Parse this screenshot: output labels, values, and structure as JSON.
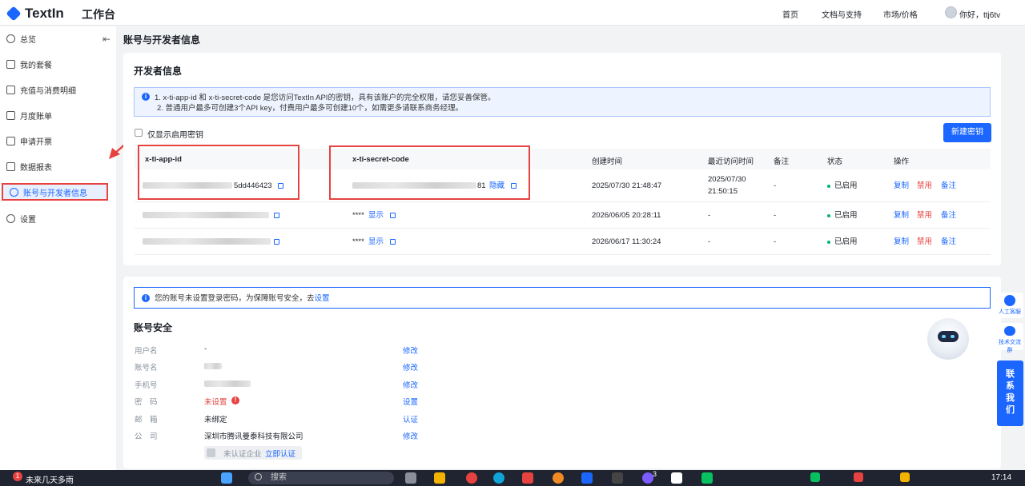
{
  "app": {
    "logo": "TextIn",
    "workbench": "工作台"
  },
  "topnav": {
    "home": "首页",
    "docs": "文档与支持",
    "market": "市场/价格",
    "greeting": "你好，ttj6tv"
  },
  "sidebar": {
    "items": [
      {
        "label": "总览",
        "icon": "dashboard-icon"
      },
      {
        "label": "我的套餐",
        "icon": "package-icon"
      },
      {
        "label": "充值与消费明细",
        "icon": "wallet-icon"
      },
      {
        "label": "月度账单",
        "icon": "bill-icon"
      },
      {
        "label": "申请开票",
        "icon": "invoice-icon"
      },
      {
        "label": "数据报表",
        "icon": "chart-icon"
      },
      {
        "label": "账号与开发者信息",
        "icon": "user-icon"
      },
      {
        "label": "设置",
        "icon": "gear-icon"
      }
    ]
  },
  "page": {
    "title": "账号与开发者信息"
  },
  "developer": {
    "title": "开发者信息",
    "notice_line1": "1. x-ti-app-id 和 x-ti-secret-code 是您访问TextIn API的密钥，具有该账户的完全权限，请您妥善保管。",
    "notice_line2": "2. 普通用户最多可创建3个API key，付费用户最多可创建10个，如需更多请联系商务经理。",
    "only_enabled": "仅显示启用密钥",
    "new_key_button": "新建密钥",
    "columns": {
      "app_id": "x-ti-app-id",
      "secret": "x-ti-secret-code",
      "created": "创建时间",
      "last_access": "最近访问时间",
      "note": "备注",
      "status": "状态",
      "action": "操作"
    },
    "rows": [
      {
        "app_id_suffix": "5dd446423",
        "secret_suffix": "81",
        "secret_toggle": "隐藏",
        "created": "2025/07/30 21:48:47",
        "last_access_date": "2025/07/30",
        "last_access_time": "21:50:15",
        "note": "-",
        "status": "已启用",
        "copy": "复制",
        "disable": "禁用",
        "remark": "备注"
      },
      {
        "secret_mask": "****",
        "secret_toggle": "显示",
        "created": "2026/06/05 20:28:11",
        "last_access": "-",
        "note": "-",
        "status": "已启用",
        "copy": "复制",
        "disable": "禁用",
        "remark": "备注"
      },
      {
        "secret_mask": "****",
        "secret_toggle": "显示",
        "created": "2026/06/17 11:30:24",
        "last_access": "-",
        "note": "-",
        "status": "已启用",
        "copy": "复制",
        "disable": "禁用",
        "remark": "备注"
      }
    ]
  },
  "security": {
    "notice": "您的账号未设置登录密码，为保障账号安全，去",
    "notice_link": "设置",
    "title": "账号安全",
    "fields": [
      {
        "label": "用户名",
        "value": "-",
        "action": "修改"
      },
      {
        "label": "账号名",
        "value": "",
        "action": "修改"
      },
      {
        "label": "手机号",
        "value": "",
        "action": "修改"
      },
      {
        "label": "密　码",
        "value": "未设置",
        "action": "设置"
      },
      {
        "label": "邮　箱",
        "value": "未绑定",
        "action": "认证"
      },
      {
        "label": "公　司",
        "value": "深圳市腾讯曼泰科技有限公司",
        "action": "修改"
      }
    ],
    "unverified": "未认证企业",
    "verify_now": "立即认证"
  },
  "float": {
    "human_service": "人工客服",
    "tech_group": "技术交流群",
    "contact": [
      "联",
      "系",
      "我",
      "们"
    ]
  },
  "taskbar": {
    "badge": "1",
    "weather": "未来几天多雨",
    "search": "搜索",
    "time": "17:14",
    "notif_count": "3"
  },
  "colors": {
    "accent": "#1a66ff",
    "danger": "#e64340",
    "success": "#00b578"
  }
}
